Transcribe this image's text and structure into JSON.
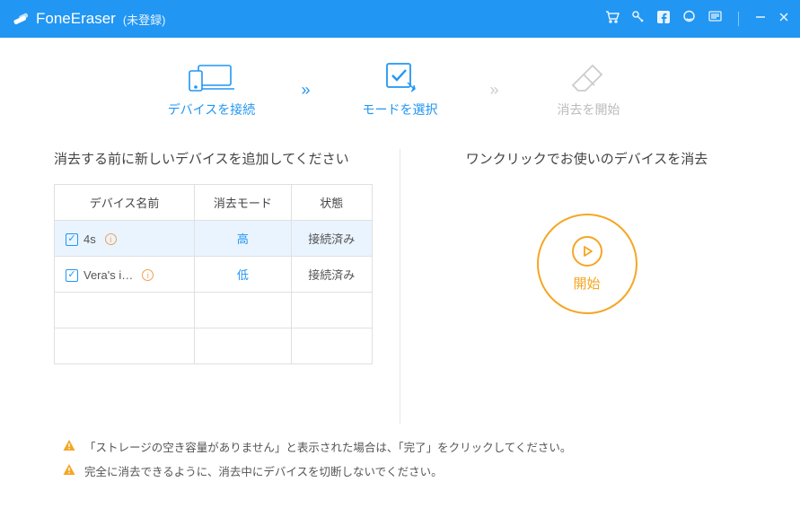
{
  "titlebar": {
    "app_name": "FoneEraser",
    "status": "(未登録)"
  },
  "steps": {
    "connect": "デバイスを接続",
    "select": "モードを選択",
    "erase": "消去を開始"
  },
  "left": {
    "title": "消去する前に新しいデバイスを追加してください",
    "headers": {
      "name": "デバイス名前",
      "mode": "消去モード",
      "state": "状態"
    },
    "rows": [
      {
        "name": "4s",
        "mode": "高",
        "state": "接続済み"
      },
      {
        "name": "Vera's i…",
        "mode": "低",
        "state": "接続済み"
      }
    ]
  },
  "right": {
    "title": "ワンクリックでお使いのデバイスを消去",
    "start": "開始"
  },
  "warnings": {
    "w1": "「ストレージの空き容量がありません」と表示された場合は、「完了」をクリックしてください。",
    "w2": "完全に消去できるように、消去中にデバイスを切断しないでください。"
  }
}
